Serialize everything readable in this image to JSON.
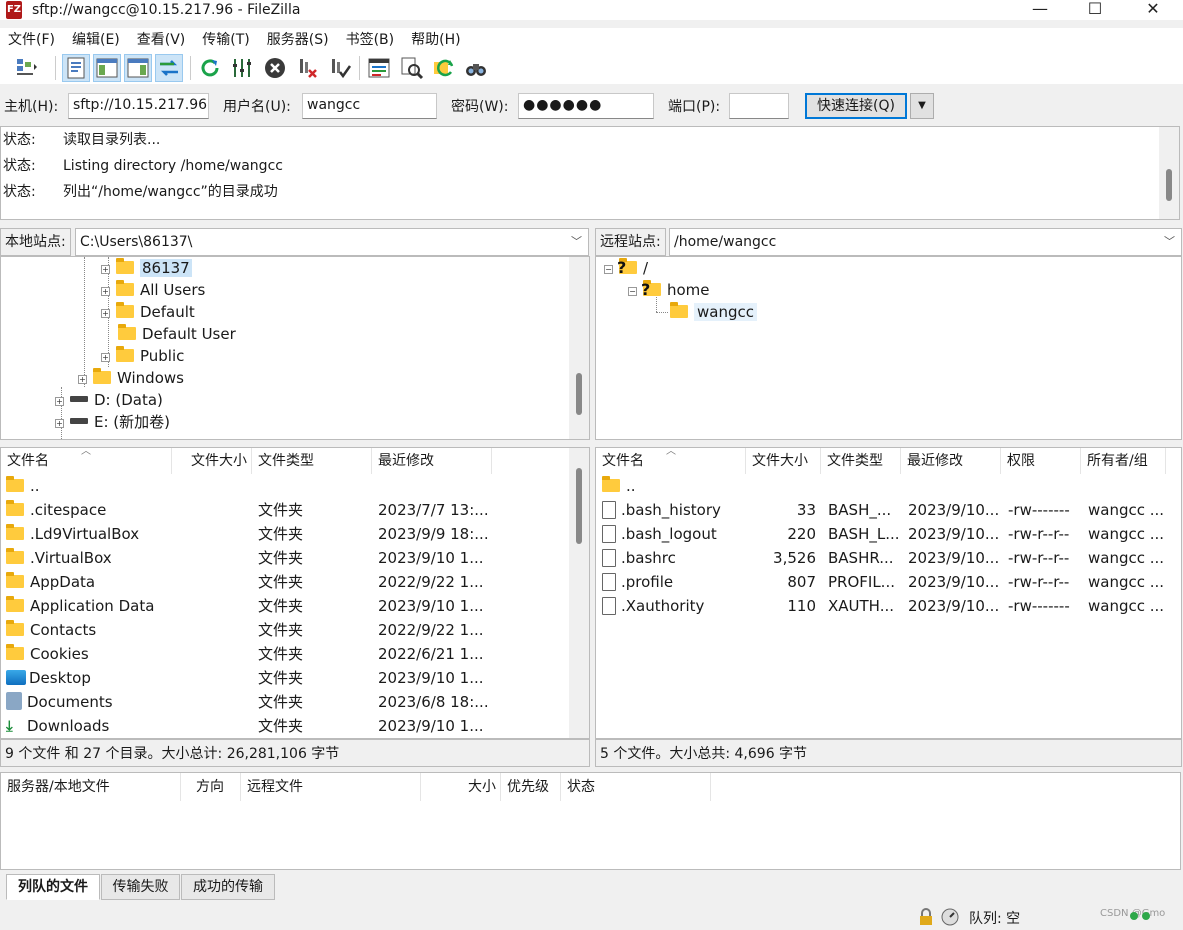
{
  "window": {
    "title": "sftp://wangcc@10.15.217.96 - FileZilla",
    "app_icon": "FZ",
    "controls": {
      "minimize": "—",
      "maximize": "☐",
      "close": "✕"
    }
  },
  "menu": [
    "文件(F)",
    "编辑(E)",
    "查看(V)",
    "传输(T)",
    "服务器(S)",
    "书签(B)",
    "帮助(H)"
  ],
  "quickconnect": {
    "host_label": "主机(H):",
    "host_value": "sftp://10.15.217.96",
    "user_label": "用户名(U):",
    "user_value": "wangcc",
    "pass_label": "密码(W):",
    "pass_value": "●●●●●●",
    "port_label": "端口(P):",
    "port_value": "",
    "connect_button": "快速连接(Q)",
    "dropdown": "▼"
  },
  "log": [
    {
      "label": "状态:",
      "text": "读取目录列表..."
    },
    {
      "label": "状态:",
      "text": "Listing directory /home/wangcc"
    },
    {
      "label": "状态:",
      "text": "列出“/home/wangcc”的目录成功"
    }
  ],
  "local": {
    "site_label": "本地站点:",
    "path": "C:\\Users\\86137\\",
    "tree": [
      {
        "name": "86137",
        "level": 2,
        "expander": "+"
      },
      {
        "name": "All Users",
        "level": 2,
        "expander": "+"
      },
      {
        "name": "Default",
        "level": 2,
        "expander": "+"
      },
      {
        "name": "Default User",
        "level": 2,
        "expander": ""
      },
      {
        "name": "Public",
        "level": 2,
        "expander": "+"
      },
      {
        "name": "Windows",
        "level": 1,
        "expander": "+"
      },
      {
        "name": "D: (Data)",
        "level": 0,
        "expander": "+",
        "drive": true
      },
      {
        "name": "E: (新加卷)",
        "level": 0,
        "expander": "+",
        "drive": true
      }
    ],
    "columns": [
      "文件名",
      "文件大小",
      "文件类型",
      "最近修改"
    ],
    "files": [
      {
        "name": "..",
        "size": "",
        "type": "",
        "modified": "",
        "icon": "folder"
      },
      {
        "name": ".citespace",
        "size": "",
        "type": "文件夹",
        "modified": "2023/7/7 13:...",
        "icon": "folder"
      },
      {
        "name": ".Ld9VirtualBox",
        "size": "",
        "type": "文件夹",
        "modified": "2023/9/9 18:...",
        "icon": "folder"
      },
      {
        "name": ".VirtualBox",
        "size": "",
        "type": "文件夹",
        "modified": "2023/9/10 1...",
        "icon": "folder"
      },
      {
        "name": "AppData",
        "size": "",
        "type": "文件夹",
        "modified": "2022/9/22 1...",
        "icon": "folder"
      },
      {
        "name": "Application Data",
        "size": "",
        "type": "文件夹",
        "modified": "2023/9/10 1...",
        "icon": "folder"
      },
      {
        "name": "Contacts",
        "size": "",
        "type": "文件夹",
        "modified": "2022/9/22 1...",
        "icon": "folder"
      },
      {
        "name": "Cookies",
        "size": "",
        "type": "文件夹",
        "modified": "2022/6/21 1...",
        "icon": "folder"
      },
      {
        "name": "Desktop",
        "size": "",
        "type": "文件夹",
        "modified": "2023/9/10 1...",
        "icon": "desktop"
      },
      {
        "name": "Documents",
        "size": "",
        "type": "文件夹",
        "modified": "2023/6/8 18:...",
        "icon": "documents"
      },
      {
        "name": "Downloads",
        "size": "",
        "type": "文件夹",
        "modified": "2023/9/10 1...",
        "icon": "downloads"
      }
    ],
    "status": "9 个文件 和 27 个目录。大小总计: 26,281,106 字节"
  },
  "remote": {
    "site_label": "远程站点:",
    "path": "/home/wangcc",
    "tree": [
      {
        "name": "/",
        "level": 0,
        "unknown": true
      },
      {
        "name": "home",
        "level": 1,
        "unknown": true
      },
      {
        "name": "wangcc",
        "level": 2
      }
    ],
    "columns": [
      "文件名",
      "文件大小",
      "文件类型",
      "最近修改",
      "权限",
      "所有者/组"
    ],
    "files": [
      {
        "name": "..",
        "size": "",
        "type": "",
        "modified": "",
        "perm": "",
        "owner": "",
        "icon": "folder"
      },
      {
        "name": ".bash_history",
        "size": "33",
        "type": "BASH_...",
        "modified": "2023/9/10...",
        "perm": "-rw-------",
        "owner": "wangcc ...",
        "icon": "file"
      },
      {
        "name": ".bash_logout",
        "size": "220",
        "type": "BASH_L...",
        "modified": "2023/9/10...",
        "perm": "-rw-r--r--",
        "owner": "wangcc ...",
        "icon": "file"
      },
      {
        "name": ".bashrc",
        "size": "3,526",
        "type": "BASHR...",
        "modified": "2023/9/10...",
        "perm": "-rw-r--r--",
        "owner": "wangcc ...",
        "icon": "file"
      },
      {
        "name": ".profile",
        "size": "807",
        "type": "PROFIL...",
        "modified": "2023/9/10...",
        "perm": "-rw-r--r--",
        "owner": "wangcc ...",
        "icon": "file"
      },
      {
        "name": ".Xauthority",
        "size": "110",
        "type": "XAUTH...",
        "modified": "2023/9/10...",
        "perm": "-rw-------",
        "owner": "wangcc ...",
        "icon": "file"
      }
    ],
    "status": "5 个文件。大小总共: 4,696 字节"
  },
  "queue": {
    "columns": [
      "服务器/本地文件",
      "方向",
      "远程文件",
      "大小",
      "优先级",
      "状态"
    ],
    "tabs": [
      "列队的文件",
      "传输失败",
      "成功的传输"
    ],
    "status": "队列: 空",
    "watermark": "CSDN @Gmo"
  },
  "icons": {
    "toolbar": [
      "site-manager-icon",
      "toggle-log-icon",
      "toggle-local-tree-icon",
      "toggle-remote-tree-icon",
      "toggle-queue-icon",
      "refresh-icon",
      "process-queue-icon",
      "cancel-icon",
      "disconnect-icon",
      "reconnect-icon",
      "filter-icon",
      "compare-icon",
      "sync-browse-icon",
      "search-icon"
    ]
  }
}
